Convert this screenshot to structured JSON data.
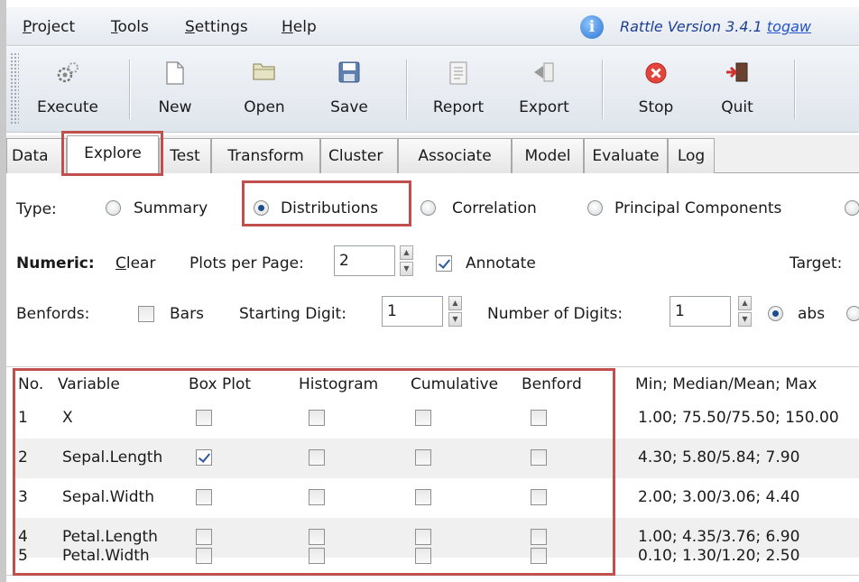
{
  "menu": {
    "items": [
      {
        "underline": "P",
        "rest": "roject"
      },
      {
        "underline": "T",
        "rest": "ools"
      },
      {
        "underline": "S",
        "rest": "ettings"
      },
      {
        "underline": "H",
        "rest": "elp"
      }
    ],
    "info_icon": "info-icon",
    "version_text": "Rattle Version 3.4.1",
    "version_link": "togaw"
  },
  "toolbar": {
    "execute": "Execute",
    "new": "New",
    "open": "Open",
    "save": "Save",
    "report": "Report",
    "export": "Export",
    "stop": "Stop",
    "quit": "Quit"
  },
  "tabs": [
    "Data",
    "Explore",
    "Test",
    "Transform",
    "Cluster",
    "Associate",
    "Model",
    "Evaluate",
    "Log"
  ],
  "type_row": {
    "label": "Type:",
    "options": [
      "Summary",
      "Distributions",
      "Correlation",
      "Principal Components"
    ],
    "selected": "Distributions"
  },
  "numeric_row": {
    "label": "Numeric:",
    "clear_underline": "C",
    "clear_rest": "lear",
    "plots_label": "Plots per Page:",
    "plots_value": "2",
    "annotate_label": "Annotate",
    "annotate_checked": true,
    "target_label": "Target:"
  },
  "benfords_row": {
    "label": "Benfords:",
    "bars_label": "Bars",
    "starting_label": "Starting Digit:",
    "starting_value": "1",
    "num_digits_label": "Number of Digits:",
    "num_digits_value": "1",
    "abs_label": "abs"
  },
  "table": {
    "headers": [
      "No.",
      "Variable",
      "Box Plot",
      "Histogram",
      "Cumulative",
      "Benford",
      "Min; Median/Mean; Max"
    ],
    "rows": [
      {
        "no": "1",
        "variable": "X",
        "box": false,
        "hist": false,
        "cum": false,
        "benford": false,
        "stats": "1.00; 75.50/75.50; 150.00"
      },
      {
        "no": "2",
        "variable": "Sepal.Length",
        "box": true,
        "hist": false,
        "cum": false,
        "benford": false,
        "stats": "4.30; 5.80/5.84; 7.90"
      },
      {
        "no": "3",
        "variable": "Sepal.Width",
        "box": false,
        "hist": false,
        "cum": false,
        "benford": false,
        "stats": "2.00; 3.00/3.06; 4.40"
      },
      {
        "no": "4",
        "variable": "Petal.Length",
        "box": false,
        "hist": false,
        "cum": false,
        "benford": false,
        "stats": "1.00; 4.35/3.76; 6.90"
      },
      {
        "no": "5",
        "variable": "Petal.Width",
        "box": false,
        "hist": false,
        "cum": false,
        "benford": false,
        "stats": "0.10; 1.30/1.20; 2.50"
      }
    ]
  },
  "colors": {
    "highlight": "#c0504d",
    "version_text": "#1c3f94",
    "radio_dot": "#1c4e8c"
  }
}
